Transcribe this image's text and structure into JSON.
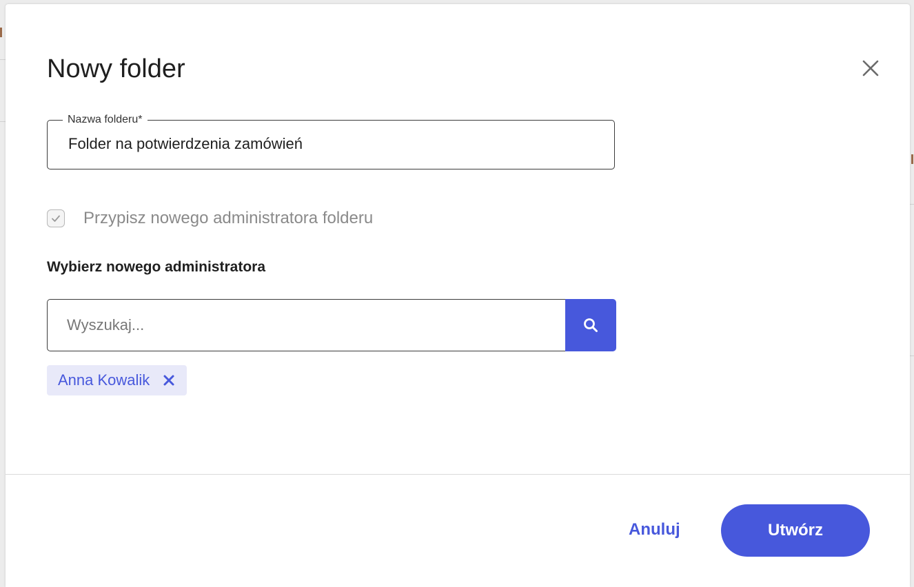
{
  "dialog": {
    "title": "Nowy folder",
    "close_icon": "close-icon"
  },
  "folder_name_field": {
    "label": "Nazwa folderu*",
    "value": "Folder na potwierdzenia zamówień"
  },
  "assign_admin": {
    "checked": true,
    "label": "Przypisz nowego administratora folderu"
  },
  "admin_section": {
    "heading": "Wybierz nowego administratora",
    "search_placeholder": "Wyszukaj...",
    "search_icon": "search-icon",
    "selected": [
      {
        "name": "Anna Kowalik",
        "remove_icon": "close-icon"
      }
    ]
  },
  "footer": {
    "cancel_label": "Anuluj",
    "create_label": "Utwórz"
  },
  "colors": {
    "accent": "#4758dc",
    "chip_bg": "#e8e9f9",
    "text": "#1f1f1f",
    "muted": "#8a8a8a"
  }
}
